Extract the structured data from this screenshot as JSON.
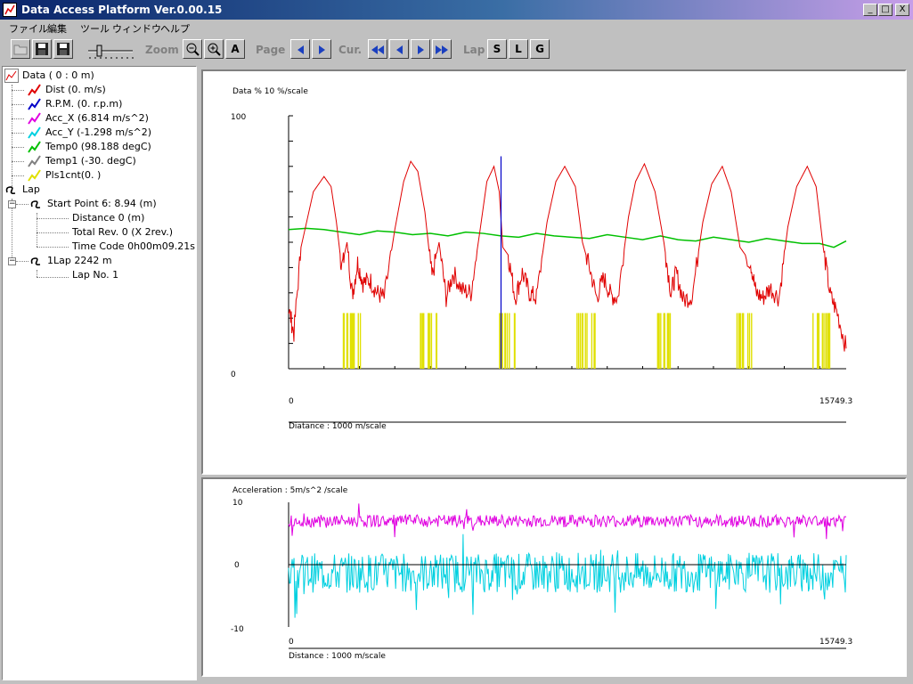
{
  "window": {
    "title": "Data Access Platform Ver.0.00.15",
    "controls": [
      "_",
      "□",
      "X"
    ]
  },
  "menu": [
    "ファイル",
    "編集",
    "ツール",
    "ウィンドウ",
    "ヘルプ"
  ],
  "toolbar": {
    "zoom_label": "Zoom",
    "zoom_out": "−",
    "zoom_in": "+",
    "zoom_auto": "A",
    "page_label": "Page",
    "cursor_label": "Cur.",
    "lap_label": "Lap",
    "lap_s": "S",
    "lap_l": "L",
    "lap_g": "G"
  },
  "tree": {
    "root": "Data ( 0 : 0 m)",
    "channels": [
      {
        "label": "Dist   (0. m/s)",
        "color": "#e00000"
      },
      {
        "label": "R.P.M.  (0. r.p.m)",
        "color": "#0000c8"
      },
      {
        "label": "Acc_X  (6.814 m/s^2)",
        "color": "#e000e0"
      },
      {
        "label": "Acc_Y  (-1.298 m/s^2)",
        "color": "#00d0e0"
      },
      {
        "label": "Temp0  (98.188 degC)",
        "color": "#00c000"
      },
      {
        "label": "Temp1  (-30. degC)",
        "color": "#808080"
      },
      {
        "label": "Pls1cnt(0. )",
        "color": "#e0e000"
      }
    ],
    "lap_root": "Lap",
    "start_point": "Start Point 6: 8.94  (m)",
    "start_children": [
      "Distance 0  (m)",
      "Total Rev. 0  (X 2rev.)",
      "Time Code 0h00m09.21s"
    ],
    "lap1": "1Lap 2242 m",
    "lap1_children": [
      "Lap No. 1"
    ]
  },
  "chart_top": {
    "title": "Data % 10 %/scale",
    "y_max_label": "100",
    "y_min_label": "0",
    "x_min_label": "0",
    "x_max_label": "15749.3",
    "x_axis_label": "Diatance :  1000 m/scale"
  },
  "chart_bottom": {
    "title": "Acceleration : 5m/s^2 /scale",
    "y_labels": [
      "10",
      "0",
      "-10"
    ],
    "x_min_label": "0",
    "x_max_label": "15749.3",
    "x_axis_label": "Distance :  1000 m/scale"
  },
  "chart_data": [
    {
      "type": "line",
      "title": "Data % 10 %/scale",
      "xlabel": "Diatance :  1000 m/scale",
      "xlim": [
        0,
        15749.3
      ],
      "ylim": [
        0,
        100
      ],
      "cursor_x": 6000,
      "series": [
        {
          "name": "Dist",
          "color": "#e00000",
          "x": [
            0,
            150,
            350,
            700,
            1000,
            1200,
            1350,
            1500,
            1650,
            1800,
            1950,
            2100,
            2300,
            2500,
            2700,
            3000,
            3250,
            3450,
            3650,
            3850,
            4050,
            4250,
            4450,
            4650,
            4900,
            5150,
            5400,
            5600,
            5800,
            5950,
            6050,
            6200,
            6400,
            6600,
            6800,
            7000,
            7300,
            7550,
            7800,
            8100,
            8300,
            8500,
            8700,
            8900,
            9100,
            9300,
            9600,
            9800,
            10050,
            10350,
            10600,
            10800,
            10950,
            11150,
            11400,
            11700,
            11950,
            12250,
            12500,
            12750,
            13050,
            13200,
            13400,
            13600,
            13850,
            14100,
            14350,
            14650,
            14900,
            15100,
            15300,
            15500,
            15749
          ],
          "y": [
            24,
            14,
            48,
            70,
            76,
            72,
            58,
            40,
            50,
            29,
            42,
            34,
            35,
            30,
            28,
            55,
            74,
            82,
            78,
            62,
            36,
            50,
            28,
            38,
            31,
            30,
            54,
            74,
            80,
            70,
            48,
            45,
            28,
            38,
            30,
            28,
            58,
            74,
            80,
            72,
            50,
            40,
            28,
            36,
            29,
            28,
            60,
            74,
            81,
            70,
            50,
            30,
            38,
            27,
            29,
            58,
            73,
            80,
            70,
            48,
            42,
            30,
            28,
            32,
            28,
            56,
            72,
            80,
            72,
            48,
            29,
            22,
            8
          ]
        },
        {
          "name": "Temp0",
          "color": "#00c000",
          "x": [
            0,
            500,
            1000,
            1500,
            2000,
            2500,
            3000,
            3500,
            4000,
            4500,
            5000,
            5500,
            6000,
            6500,
            7000,
            7500,
            8000,
            8500,
            9000,
            9500,
            10000,
            10500,
            11000,
            11500,
            12000,
            12500,
            13000,
            13500,
            14000,
            14500,
            15000,
            15400,
            15749
          ],
          "y": [
            55,
            55.5,
            55,
            54,
            53,
            54.5,
            54,
            53,
            53.5,
            52.5,
            54,
            53.5,
            52.5,
            52,
            53.5,
            52.5,
            52,
            51.5,
            53,
            52,
            51,
            52.5,
            51,
            50.5,
            52,
            51,
            50,
            51.5,
            50.5,
            49.5,
            49.5,
            48,
            50.5
          ]
        },
        {
          "name": "Pls1cnt",
          "color": "#e0e000",
          "x": [
            1500,
            2100,
            3700,
            4200,
            5900,
            6400,
            8100,
            8700,
            10400,
            10900,
            12600,
            13100,
            14800,
            15300
          ],
          "y": [
            0,
            22,
            0,
            22,
            0,
            22,
            0,
            22,
            0,
            22,
            0,
            22,
            0,
            22
          ]
        }
      ]
    },
    {
      "type": "line",
      "title": "Acceleration : 5m/s^2 /scale",
      "xlabel": "Distance :  1000 m/scale",
      "xlim": [
        0,
        15749.3
      ],
      "ylim": [
        -10,
        10
      ],
      "series": [
        {
          "name": "Acc_X",
          "color": "#e000e0",
          "base": 7,
          "noise": 1.0
        },
        {
          "name": "Acc_Y",
          "color": "#00d0e0",
          "base": -1.3,
          "noise": 3.2
        }
      ]
    }
  ]
}
